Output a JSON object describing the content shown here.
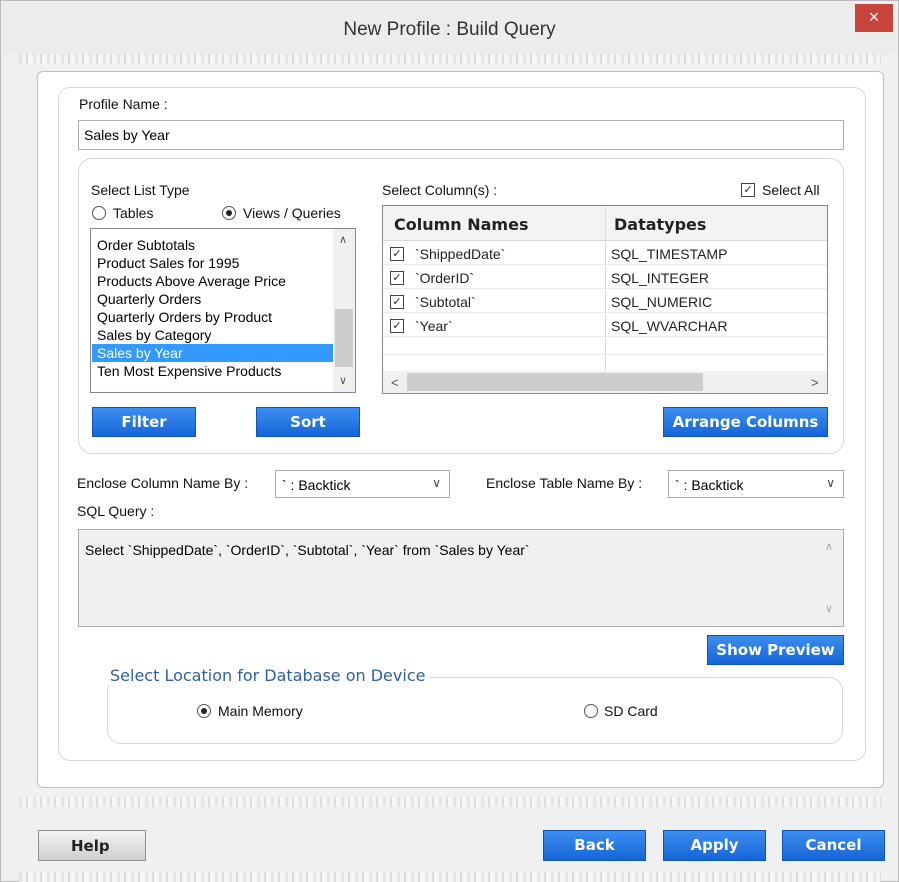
{
  "window": {
    "title": "New Profile : Build Query",
    "close_glyph": "×"
  },
  "profile": {
    "label": "Profile Name :",
    "value": "Sales by Year"
  },
  "list_type": {
    "label": "Select List Type",
    "options": [
      {
        "label": "Tables",
        "selected": false
      },
      {
        "label": "Views / Queries",
        "selected": true
      }
    ],
    "items": [
      "Order Subtotals",
      "Product Sales for 1995",
      "Products Above Average Price",
      "Quarterly Orders",
      "Quarterly Orders by Product",
      "Sales by Category",
      "Sales by Year",
      "Ten Most Expensive Products"
    ],
    "selected_item": "Sales by Year",
    "filter_label": "Filter",
    "sort_label": "Sort"
  },
  "columns": {
    "label": "Select Column(s) :",
    "select_all_label": "Select All",
    "select_all_checked": true,
    "headers": [
      "Column Names",
      "Datatypes"
    ],
    "rows": [
      {
        "checked": true,
        "name": "`ShippedDate`",
        "type": "SQL_TIMESTAMP"
      },
      {
        "checked": true,
        "name": "`OrderID`",
        "type": "SQL_INTEGER"
      },
      {
        "checked": true,
        "name": "`Subtotal`",
        "type": "SQL_NUMERIC"
      },
      {
        "checked": true,
        "name": "`Year`",
        "type": "SQL_WVARCHAR"
      }
    ],
    "arrange_label": "Arrange Columns",
    "check_glyph": "✓"
  },
  "enclose": {
    "column_label": "Enclose Column Name By :",
    "column_value": "` : Backtick",
    "table_label": "Enclose Table Name By :",
    "table_value": "` : Backtick"
  },
  "sql": {
    "label": "SQL Query :",
    "text": "Select `ShippedDate`, `OrderID`, `Subtotal`, `Year` from `Sales by Year`",
    "preview_label": "Show Preview"
  },
  "location": {
    "title": "Select Location for Database on Device",
    "options": [
      {
        "label": "Main Memory",
        "selected": true
      },
      {
        "label": "SD Card",
        "selected": false
      }
    ]
  },
  "footer": {
    "help": "Help",
    "back": "Back",
    "apply": "Apply",
    "cancel": "Cancel"
  },
  "icons": {
    "chevron_down": "∨",
    "chevron_up": "∧",
    "left": "<",
    "right": ">"
  },
  "colors": {
    "accent": "#1565d8",
    "close": "#c7443a",
    "selection": "#3399ff",
    "group_title": "#2d5fa8"
  }
}
